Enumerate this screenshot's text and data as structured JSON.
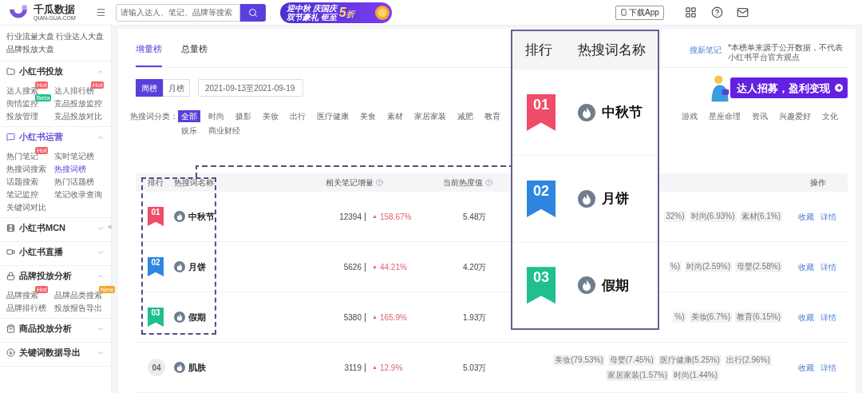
{
  "header": {
    "logo": {
      "name": "千瓜数据",
      "domain": "QIAN-GUA.COM"
    },
    "search": {
      "placeholder": "请输入达人、笔记、品牌等搜索"
    },
    "promo": {
      "line_1": "迎中秋 庆国庆",
      "line_2": "双节豪礼 钜至",
      "discount_number": "5",
      "discount_unit": "折"
    },
    "download_button": "下载App"
  },
  "sidebar": {
    "top_links": [
      "行业流量大盘",
      "行业达人大盘",
      "品牌投放大盘"
    ],
    "collapse_handle": "«",
    "sections": [
      {
        "title": "小红书投放",
        "expanded": true,
        "active": false,
        "items": [
          {
            "label": "达人搜索",
            "selected": false,
            "badge": {
              "text": "Hot",
              "color": "#f2626b"
            }
          },
          {
            "label": "达人排行榜",
            "selected": false,
            "badge": {
              "text": "Hot",
              "color": "#f2626b"
            }
          },
          {
            "label": "舆情监控",
            "selected": false,
            "badge": {
              "text": "Beta",
              "color": "#22c28a"
            }
          },
          {
            "label": "竞品投放监控",
            "selected": false
          },
          {
            "label": "投放管理",
            "selected": false
          },
          {
            "label": "竞品投放对比",
            "selected": false
          }
        ]
      },
      {
        "title": "小红书运营",
        "expanded": true,
        "active": true,
        "items": [
          {
            "label": "热门笔记",
            "selected": false,
            "badge": {
              "text": "Hot",
              "color": "#f2626b"
            }
          },
          {
            "label": "实时笔记榜",
            "selected": false
          },
          {
            "label": "热搜词搜索",
            "selected": false
          },
          {
            "label": "热搜词榜",
            "selected": true
          },
          {
            "label": "话题搜索",
            "selected": false
          },
          {
            "label": "热门话题榜",
            "selected": false
          },
          {
            "label": "笔记监控",
            "selected": false
          },
          {
            "label": "笔记收录查询",
            "selected": false
          },
          {
            "label": "关键词对比",
            "selected": false
          }
        ]
      },
      {
        "title": "小红书MCN",
        "expanded": false,
        "active": false
      },
      {
        "title": "小红书直播",
        "expanded": false,
        "active": false
      },
      {
        "title": "品牌投放分析",
        "expanded": true,
        "active": false,
        "items": [
          {
            "label": "品牌搜索",
            "selected": false,
            "badge": {
              "text": "Hot",
              "color": "#f2626b"
            }
          },
          {
            "label": "品牌品类搜索",
            "selected": false,
            "badge": {
              "text": "New",
              "color": "#f5a623"
            }
          },
          {
            "label": "品牌排行榜",
            "selected": false
          },
          {
            "label": "投放报告导出",
            "selected": false
          }
        ]
      },
      {
        "title": "商品投放分析",
        "expanded": false,
        "active": false
      },
      {
        "title": "关键词数据导出",
        "expanded": false,
        "active": false
      }
    ]
  },
  "tabs": [
    {
      "label": "增量榜",
      "selected": true
    },
    {
      "label": "总量榜",
      "selected": false
    }
  ],
  "related_link": "搜新笔记",
  "notice": "*本榜单来源于公开数据，不代表小红书平台官方观点",
  "period_toggle": [
    {
      "label": "周榜",
      "selected": true
    },
    {
      "label": "月榜",
      "selected": false
    }
  ],
  "date_range": "2021-09-13至2021-09-19",
  "recruit_banner": {
    "text": "达人招募，盈利变现"
  },
  "categories": {
    "label": "热搜词分类：",
    "lines": [
      {
        "segments": [
          [
            {
              "label": "全部",
              "selected": true
            },
            {
              "label": "时尚",
              "selected": false
            },
            {
              "label": "摄影",
              "selected": false
            },
            {
              "label": "美妆",
              "selected": false
            },
            {
              "label": "出行",
              "selected": false
            },
            {
              "label": "医疗健康",
              "selected": false
            },
            {
              "label": "美食",
              "selected": false
            },
            {
              "label": "素材",
              "selected": false
            },
            {
              "label": "家居家装",
              "selected": false
            },
            {
              "label": "减肥",
              "selected": false
            },
            {
              "label": "教育",
              "selected": false
            }
          ],
          [
            {
              "label": "游戏",
              "selected": false
            },
            {
              "label": "星座命理",
              "selected": false
            },
            {
              "label": "资讯",
              "selected": false
            },
            {
              "label": "兴趣爱好",
              "selected": false
            },
            {
              "label": "文化",
              "selected": false
            }
          ]
        ]
      },
      {
        "segments": [
          [
            {
              "label": "娱乐",
              "selected": false
            },
            {
              "label": "商业财经",
              "selected": false
            }
          ]
        ]
      }
    ]
  },
  "table": {
    "columns": [
      "排行",
      "热搜词名称",
      "相关笔记增量",
      "当前热度值",
      "操作"
    ],
    "rows": [
      {
        "rank": "01",
        "kind": "ribbon",
        "color": "#ef4d68",
        "keyword": "中秋节",
        "notes": "12394",
        "trend": "▲",
        "growth": "158.67%",
        "heat": "5.48万",
        "tags": [
          "32%)",
          "时尚(6.93%)",
          "素材(6.1%)"
        ],
        "actions": [
          "收藏",
          "详情"
        ]
      },
      {
        "rank": "02",
        "kind": "ribbon",
        "color": "#2f86e0",
        "keyword": "月饼",
        "notes": "5626",
        "trend": "▲",
        "growth": "44.21%",
        "heat": "4.20万",
        "tags": [
          "%)",
          "时尚(2.59%)",
          "母婴(2.58%)"
        ],
        "actions": [
          "收藏",
          "详情"
        ]
      },
      {
        "rank": "03",
        "kind": "ribbon",
        "color": "#1fbf8f",
        "keyword": "假期",
        "notes": "5380",
        "trend": "▲",
        "growth": "165.9%",
        "heat": "1.93万",
        "tags": [
          "%)",
          "美妆(6.7%)",
          "教育(6.15%)"
        ],
        "actions": [
          "收藏",
          "详情"
        ]
      },
      {
        "rank": "04",
        "kind": "circle",
        "color": "#ececec",
        "keyword": "肌肤",
        "notes": "3119",
        "trend": "▲",
        "growth": "12.9%",
        "heat": "5.03万",
        "tags": [
          "美妆(79.53%)",
          "母婴(7.45%)",
          "医疗健康(5.25%)",
          "出行(2.96%)",
          "家居家装(1.57%)",
          "时尚(1.44%)"
        ],
        "actions": [
          "收藏",
          "详情"
        ]
      }
    ]
  },
  "callout": {
    "columns": [
      "排行",
      "热搜词名称"
    ],
    "rows": [
      {
        "rank": "01",
        "color": "#ef4d68",
        "keyword": "中秋节"
      },
      {
        "rank": "02",
        "color": "#2f86e0",
        "keyword": "月饼"
      },
      {
        "rank": "03",
        "color": "#1fbf8f",
        "keyword": "假期"
      }
    ]
  }
}
